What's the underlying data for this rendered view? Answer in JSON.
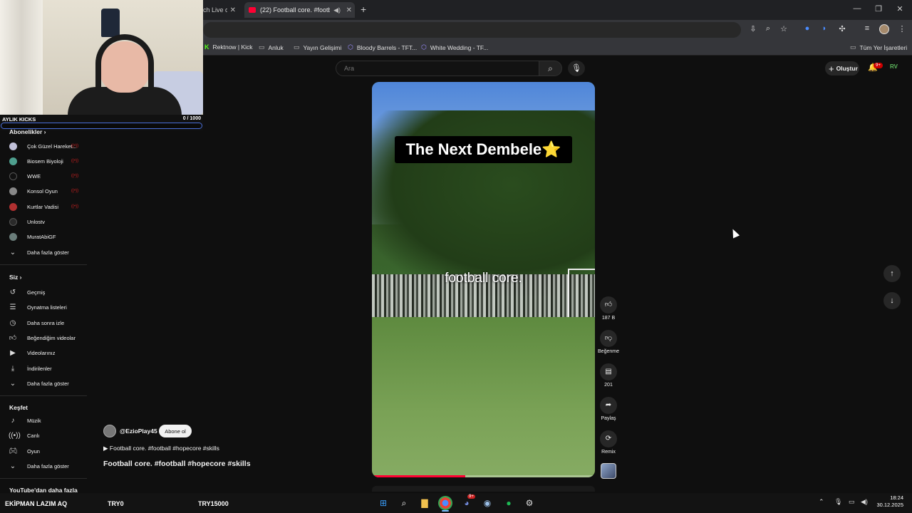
{
  "browser": {
    "tabs": [
      {
        "label": "ch Live o"
      },
      {
        "label": "(22) Football core. #football"
      }
    ],
    "bookmarks": [
      {
        "label": "Rektnow | Kick",
        "icon": "kick-icon"
      },
      {
        "label": "Anluk",
        "icon": "folder-icon"
      },
      {
        "label": "Yayın Gelişimi",
        "icon": "folder-icon"
      },
      {
        "label": "Bloody Barrels - TFT...",
        "icon": "tft-icon"
      },
      {
        "label": "White Wedding - TF...",
        "icon": "tft-icon"
      }
    ],
    "all_bookmarks": "Tüm Yer İşaretleri"
  },
  "webcam": {
    "kick_title": "AYLIK KICKS",
    "kick_count": "0 / 1000",
    "kick_progress": 0
  },
  "masthead": {
    "search_placeholder": "Ara",
    "create_label": "Oluştur",
    "notification_count": "9+",
    "avatar_initials": "RV"
  },
  "sidebar": {
    "subscriptions_heading": "Abonelikler",
    "subscriptions": [
      {
        "label": "Çok Güzel Hareket...",
        "color": "#c0c0d8",
        "live": true
      },
      {
        "label": "Biosem Biyoloji",
        "color": "#4e9f8e",
        "live": true
      },
      {
        "label": "WWE",
        "color": "#111111",
        "live": true
      },
      {
        "label": "Konsol Oyun",
        "color": "#888888",
        "live": true
      },
      {
        "label": "Kurtlar Vadisi",
        "color": "#b03030",
        "live": true
      },
      {
        "label": "Unlostv",
        "color": "#2a2a2a",
        "live": false
      },
      {
        "label": "MuratAbiGF",
        "color": "#6a7d7a",
        "live": false
      }
    ],
    "show_more_1": "Daha fazla göster",
    "you_heading": "Siz",
    "you_items": [
      {
        "label": "Geçmiş",
        "icon": "history-icon"
      },
      {
        "label": "Oynatma listeleri",
        "icon": "playlist-icon"
      },
      {
        "label": "Daha sonra izle",
        "icon": "watch-later-icon"
      },
      {
        "label": "Beğendiğim videolar",
        "icon": "like-icon"
      },
      {
        "label": "Videolarınız",
        "icon": "your-videos-icon"
      },
      {
        "label": "İndirilenler",
        "icon": "download-icon"
      }
    ],
    "show_more_2": "Daha fazla göster",
    "explore_heading": "Keşfet",
    "explore_items": [
      {
        "label": "Müzik",
        "icon": "music-icon"
      },
      {
        "label": "Canlı",
        "icon": "live-icon"
      },
      {
        "label": "Oyun",
        "icon": "gaming-icon"
      }
    ],
    "show_more_3": "Daha fazla göster",
    "more_from": "YouTube'dan daha fazla"
  },
  "short": {
    "overlay_title": "The Next Dembele⭐",
    "caption": "football core.",
    "progress": 0.42,
    "likes": "187 B",
    "dislike_label": "Beğenme",
    "comments": "201",
    "share_label": "Paylaş",
    "remix_label": "Remix",
    "channel": "@EzioPlay45",
    "subscribe_label": "Abone ol",
    "hashtags_line": "▶ Football core. #football #hopecore #skills",
    "title": "Football core. #football #hopecore #skills"
  },
  "stream_overlay": {
    "text1": "EKİPMAN LAZIM AQ",
    "text2": "TRY0",
    "text3": "TRY15000"
  },
  "taskbar": {
    "time": "18:24",
    "date": "30.12.2025",
    "discord_badge": "9+"
  }
}
